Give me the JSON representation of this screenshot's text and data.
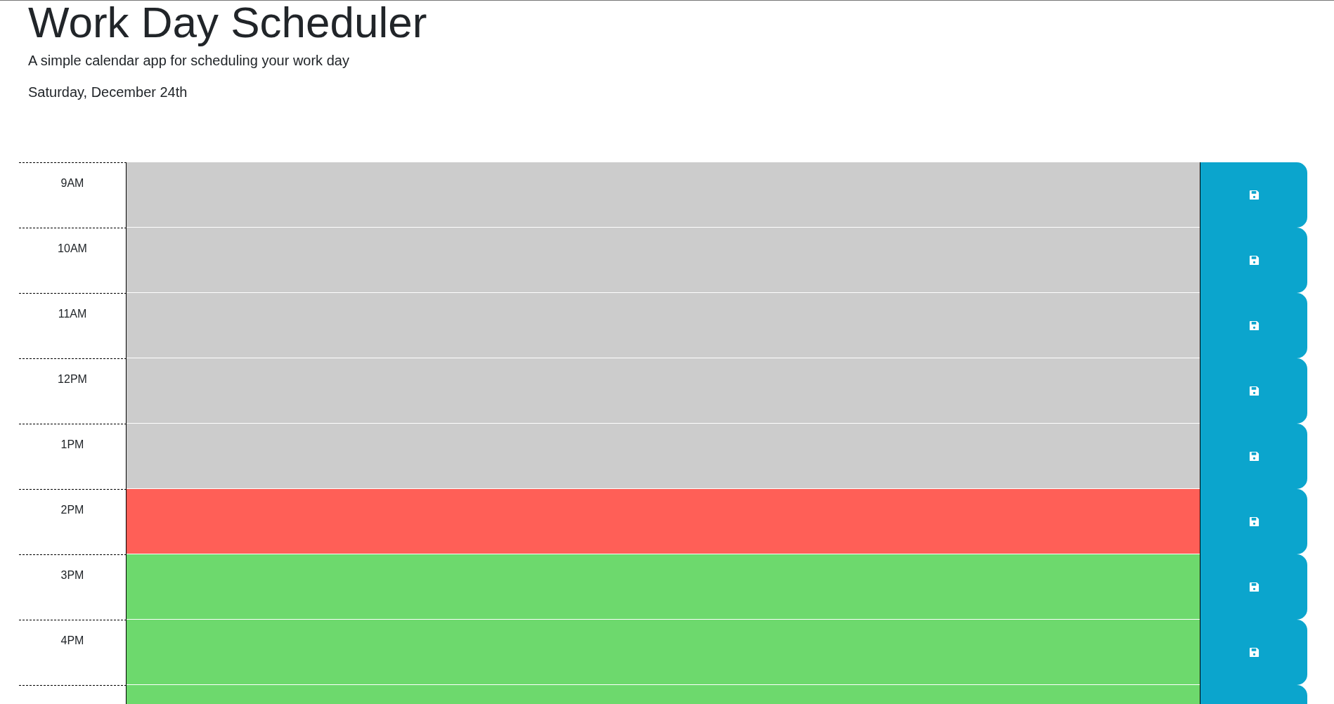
{
  "header": {
    "title": "Work Day Scheduler",
    "subtitle": "A simple calendar app for scheduling your work day",
    "date": "Saturday, December 24th"
  },
  "hours": [
    {
      "hour": "9AM",
      "color": "#cccccc"
    },
    {
      "hour": "10AM",
      "color": "#cccccc"
    },
    {
      "hour": "11AM",
      "color": "#cccccc"
    },
    {
      "hour": "12PM",
      "color": "#cccccc"
    },
    {
      "hour": "1PM",
      "color": "#cccccc"
    },
    {
      "hour": "2PM",
      "color": "#ff5f57"
    },
    {
      "hour": "3PM",
      "color": "#6dd96d"
    },
    {
      "hour": "4PM",
      "color": "#6dd96d"
    },
    {
      "color": "#6dd96d"
    }
  ]
}
